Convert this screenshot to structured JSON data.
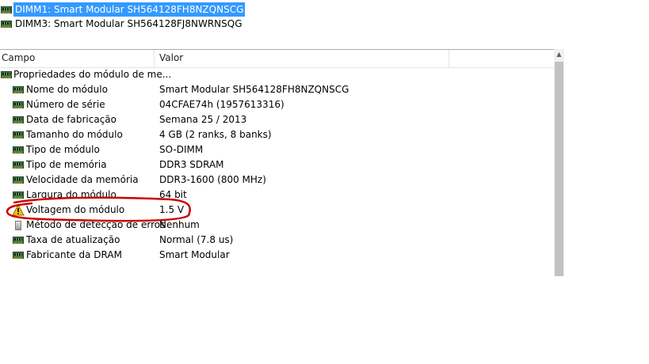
{
  "devices": [
    {
      "label": "DIMM1: Smart Modular SH564128FH8NZQNSCG",
      "selected": true
    },
    {
      "label": "DIMM3: Smart Modular SH564128FJ8NWRNSQG",
      "selected": false
    }
  ],
  "columns": {
    "field": "Campo",
    "value": "Valor"
  },
  "group_label": "Propriedades do módulo de me...",
  "properties": [
    {
      "field": "Nome do módulo",
      "value": "Smart Modular SH564128FH8NZQNSCG",
      "icon": "memory-module-icon"
    },
    {
      "field": "Número de série",
      "value": "04CFAE74h (1957613316)",
      "icon": "memory-module-icon"
    },
    {
      "field": "Data de fabricação",
      "value": "Semana 25 / 2013",
      "icon": "memory-module-icon"
    },
    {
      "field": "Tamanho do módulo",
      "value": "4 GB (2 ranks, 8 banks)",
      "icon": "memory-module-icon"
    },
    {
      "field": "Tipo de módulo",
      "value": "SO-DIMM",
      "icon": "memory-module-icon"
    },
    {
      "field": "Tipo de memória",
      "value": "DDR3 SDRAM",
      "icon": "memory-module-icon"
    },
    {
      "field": "Velocidade da memória",
      "value": "DDR3-1600 (800 MHz)",
      "icon": "memory-module-icon"
    },
    {
      "field": "Largura do módulo",
      "value": "64 bit",
      "icon": "memory-module-icon"
    },
    {
      "field": "Voltagem do módulo",
      "value": "1.5 V",
      "icon": "warning-icon"
    },
    {
      "field": "Método de detecção de erros",
      "value": "Nenhum",
      "icon": "disk-icon"
    },
    {
      "field": "Taxa de atualização",
      "value": "Normal (7.8 us)",
      "icon": "memory-module-icon"
    },
    {
      "field": "Fabricante da DRAM",
      "value": "Smart Modular",
      "icon": "memory-module-icon"
    }
  ],
  "colors": {
    "selection": "#3399ff",
    "annotation": "#cc0000",
    "module_green": "#3f7a3f"
  }
}
